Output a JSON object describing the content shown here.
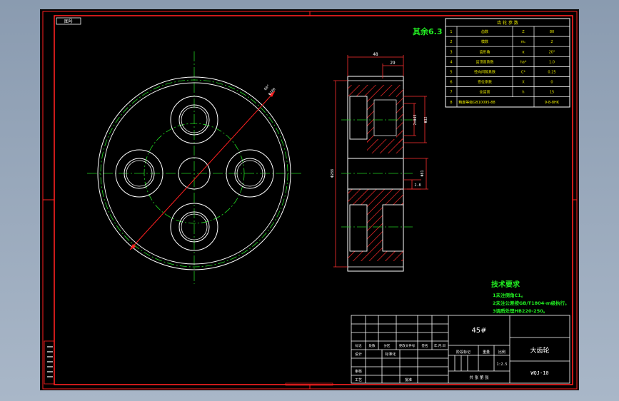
{
  "colors": {
    "background": "#000000",
    "frame": "#ff2020",
    "outline": "#ffffff",
    "green": "#22dd22",
    "centerline": "#22cc22",
    "hatch": "#ff2a2a",
    "dim": "#ff3030",
    "table_text": "#e8e800"
  },
  "drawing": {
    "code_box": "图号",
    "roughness_note": "其余6.3",
    "dimensions": {
      "top_width": "48",
      "sub_width": "29",
      "bore": "Φ32",
      "hub_dim": "2×Φ45",
      "outer_diameter": "Φ288",
      "hub_diameter": "Φ81",
      "keyway_depth": "2.8",
      "angle_label": "60°",
      "angle_value": "Φ180"
    },
    "gear_params": {
      "title": "齿 轮 参 数",
      "rows": [
        {
          "no": "1",
          "name": "齿数",
          "symbol": "Z",
          "value": "80"
        },
        {
          "no": "2",
          "name": "模数",
          "symbol": "mₙ",
          "value": "2"
        },
        {
          "no": "3",
          "name": "齿形角",
          "symbol": "α",
          "value": "20°"
        },
        {
          "no": "4",
          "name": "齿顶高系数",
          "symbol": "ha*",
          "value": "1.0"
        },
        {
          "no": "5",
          "name": "径向间隙系数",
          "symbol": "C*",
          "value": "0.25"
        },
        {
          "no": "6",
          "name": "变位系数",
          "symbol": "X",
          "value": "0"
        },
        {
          "no": "7",
          "name": "全齿高",
          "symbol": "h",
          "value": "15"
        },
        {
          "no": "8",
          "name": "精度等级GB10095-88",
          "symbol": "",
          "value": "9-8-8HK"
        }
      ]
    },
    "tech_requirements": {
      "title": "技术要求",
      "items": [
        "1未注倒角C1。",
        "2未注公差按GB/T1804-m级执行。",
        "3调质处理HB220-250。"
      ]
    },
    "title_block": {
      "material": "45#",
      "part_name": "大齿轮",
      "drawing_number": "WQJ-10",
      "scale": "1:2.5",
      "stage_mark": "阶段标记",
      "weight": "重量",
      "scale_label": "比例",
      "sheets": "共 张 第 张",
      "rev_headers": [
        "标记",
        "处数",
        "分区",
        "更改文件号",
        "签名",
        "年.月.日"
      ],
      "designer": "设计",
      "standardize": "标准化",
      "reviewer": "审核",
      "process": "工艺",
      "approve": "批准"
    }
  }
}
